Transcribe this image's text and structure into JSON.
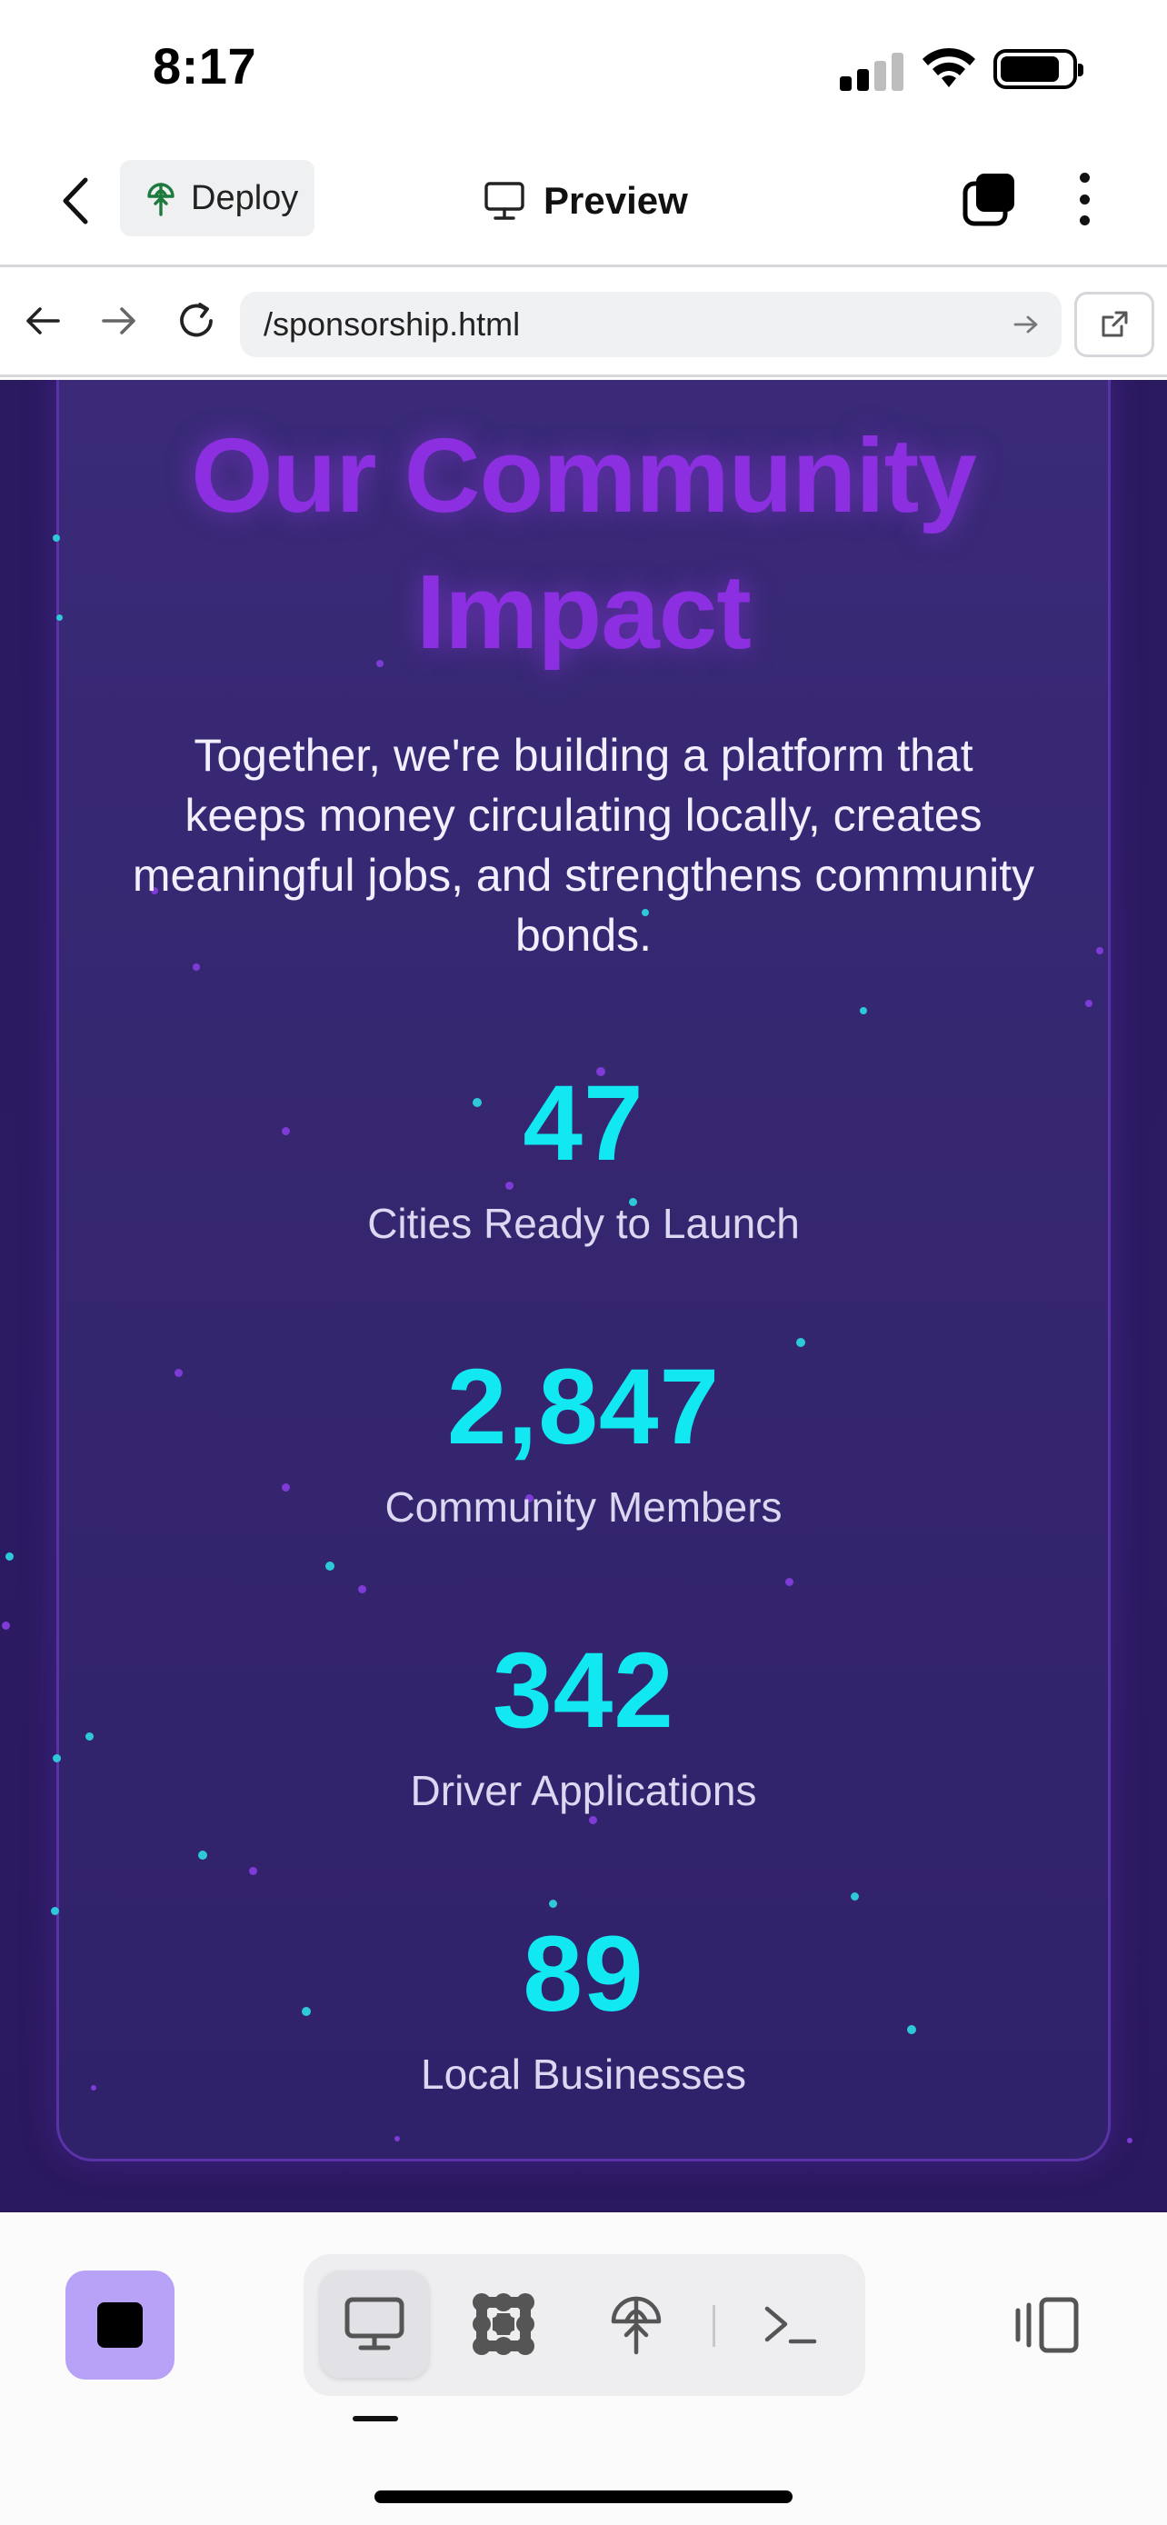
{
  "status_bar": {
    "time": "8:17"
  },
  "header": {
    "deploy_label": "Deploy",
    "title": "Preview",
    "icons": [
      "back-chevron-icon",
      "deploy-icon",
      "monitor-icon",
      "tabs-icon",
      "more-vertical-icon"
    ]
  },
  "browser": {
    "url": "/sponsorship.html",
    "icons": [
      "arrow-left-icon",
      "arrow-right-icon",
      "reload-icon",
      "go-arrow-icon",
      "external-link-icon"
    ]
  },
  "page": {
    "heading_line1": "Our Community",
    "heading_line2": "Impact",
    "subtext": "Together, we're building a platform that keeps money circulating locally, creates meaningful jobs, and strengthens community bonds.",
    "stats": [
      {
        "value": "47",
        "label": "Cities Ready to Launch"
      },
      {
        "value": "2,847",
        "label": "Community Members"
      },
      {
        "value": "342",
        "label": "Driver Applications"
      },
      {
        "value": "89",
        "label": "Local Businesses"
      }
    ],
    "colors": {
      "heading": "#8b2fe0",
      "stat_number": "#11e8f2",
      "background": "#2a1a5f"
    }
  },
  "toolbar": {
    "active_tab": "preview",
    "icons": [
      "stop-icon",
      "monitor-icon",
      "puzzle-icon",
      "deploy-icon",
      "terminal-icon",
      "layout-toggle-icon"
    ],
    "accent": "#b8a2f8"
  }
}
